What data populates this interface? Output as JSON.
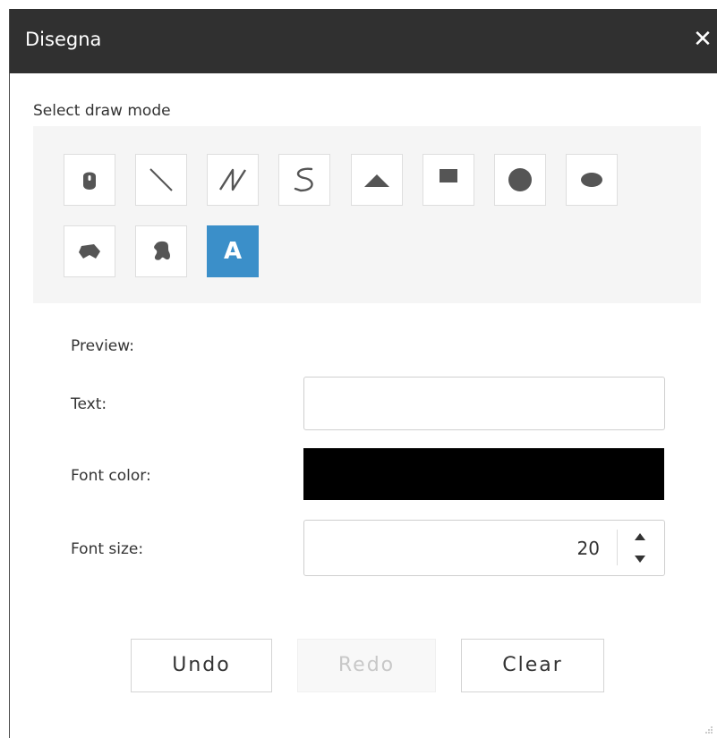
{
  "window": {
    "title": "Disegna",
    "close_symbol": "✕"
  },
  "draw_mode": {
    "label": "Select draw mode",
    "tools": [
      {
        "name": "marker",
        "icon": "map-marker-icon",
        "active": false
      },
      {
        "name": "line",
        "icon": "line-icon",
        "active": false
      },
      {
        "name": "polyline",
        "icon": "polyline-icon",
        "active": false
      },
      {
        "name": "freehand-line",
        "icon": "freehand-line-icon",
        "active": false
      },
      {
        "name": "triangle",
        "icon": "triangle-icon",
        "active": false
      },
      {
        "name": "rectangle",
        "icon": "rectangle-icon",
        "active": false
      },
      {
        "name": "circle",
        "icon": "circle-icon",
        "active": false
      },
      {
        "name": "ellipse",
        "icon": "ellipse-icon",
        "active": false
      },
      {
        "name": "polygon",
        "icon": "polygon-icon",
        "active": false
      },
      {
        "name": "freehand-polygon",
        "icon": "freehand-polygon-icon",
        "active": false
      },
      {
        "name": "text",
        "icon": "text-icon",
        "active": true,
        "glyph": "A"
      }
    ]
  },
  "form": {
    "preview_label": "Preview:",
    "text_label": "Text:",
    "text_value": "",
    "font_color_label": "Font color:",
    "font_color_value": "#000000",
    "font_size_label": "Font size:",
    "font_size_value": "20"
  },
  "actions": {
    "undo": "Undo",
    "redo": "Redo",
    "redo_disabled": true,
    "clear": "Clear"
  },
  "colors": {
    "titlebar": "#303030",
    "accent": "#3b8fc9",
    "icon_gray": "#555555",
    "mode_box_bg": "#f5f5f5"
  }
}
